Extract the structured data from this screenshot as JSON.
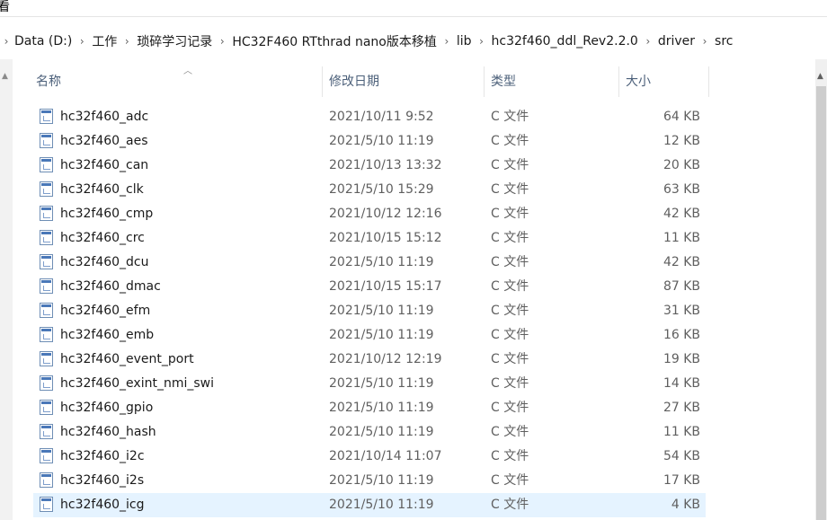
{
  "ribbon": {
    "view_label": "看"
  },
  "breadcrumb": [
    "Data (D:)",
    "工作",
    "琐碎学习记录",
    "HC32F460 RTthrad nano版本移植",
    "lib",
    "hc32f460_ddl_Rev2.2.0",
    "driver",
    "src"
  ],
  "columns": {
    "name": "名称",
    "date": "修改日期",
    "type": "类型",
    "size": "大小"
  },
  "files": [
    {
      "name": "hc32f460_adc",
      "date": "2021/10/11 9:52",
      "type": "C 文件",
      "size": "64 KB"
    },
    {
      "name": "hc32f460_aes",
      "date": "2021/5/10 11:19",
      "type": "C 文件",
      "size": "12 KB"
    },
    {
      "name": "hc32f460_can",
      "date": "2021/10/13 13:32",
      "type": "C 文件",
      "size": "20 KB"
    },
    {
      "name": "hc32f460_clk",
      "date": "2021/5/10 15:29",
      "type": "C 文件",
      "size": "63 KB"
    },
    {
      "name": "hc32f460_cmp",
      "date": "2021/10/12 12:16",
      "type": "C 文件",
      "size": "42 KB"
    },
    {
      "name": "hc32f460_crc",
      "date": "2021/10/15 15:12",
      "type": "C 文件",
      "size": "11 KB"
    },
    {
      "name": "hc32f460_dcu",
      "date": "2021/5/10 11:19",
      "type": "C 文件",
      "size": "42 KB"
    },
    {
      "name": "hc32f460_dmac",
      "date": "2021/10/15 15:17",
      "type": "C 文件",
      "size": "87 KB"
    },
    {
      "name": "hc32f460_efm",
      "date": "2021/5/10 11:19",
      "type": "C 文件",
      "size": "31 KB"
    },
    {
      "name": "hc32f460_emb",
      "date": "2021/5/10 11:19",
      "type": "C 文件",
      "size": "16 KB"
    },
    {
      "name": "hc32f460_event_port",
      "date": "2021/10/12 12:19",
      "type": "C 文件",
      "size": "19 KB"
    },
    {
      "name": "hc32f460_exint_nmi_swi",
      "date": "2021/5/10 11:19",
      "type": "C 文件",
      "size": "14 KB"
    },
    {
      "name": "hc32f460_gpio",
      "date": "2021/5/10 11:19",
      "type": "C 文件",
      "size": "27 KB"
    },
    {
      "name": "hc32f460_hash",
      "date": "2021/5/10 11:19",
      "type": "C 文件",
      "size": "11 KB"
    },
    {
      "name": "hc32f460_i2c",
      "date": "2021/10/14 11:07",
      "type": "C 文件",
      "size": "54 KB"
    },
    {
      "name": "hc32f460_i2s",
      "date": "2021/5/10 11:19",
      "type": "C 文件",
      "size": "17 KB"
    },
    {
      "name": "hc32f460_icg",
      "date": "2021/5/10 11:19",
      "type": "C 文件",
      "size": "4 KB",
      "selected": true
    }
  ],
  "icons": {
    "file": "c-source-file-icon",
    "breadcrumb_separator": "chevron-right-icon",
    "sort": "sort-up-icon",
    "scroll": "scroll-up-icon"
  },
  "colors": {
    "selection": "#e5f3ff",
    "header_text": "#4c607a",
    "secondary_text": "#5f5f5f"
  }
}
